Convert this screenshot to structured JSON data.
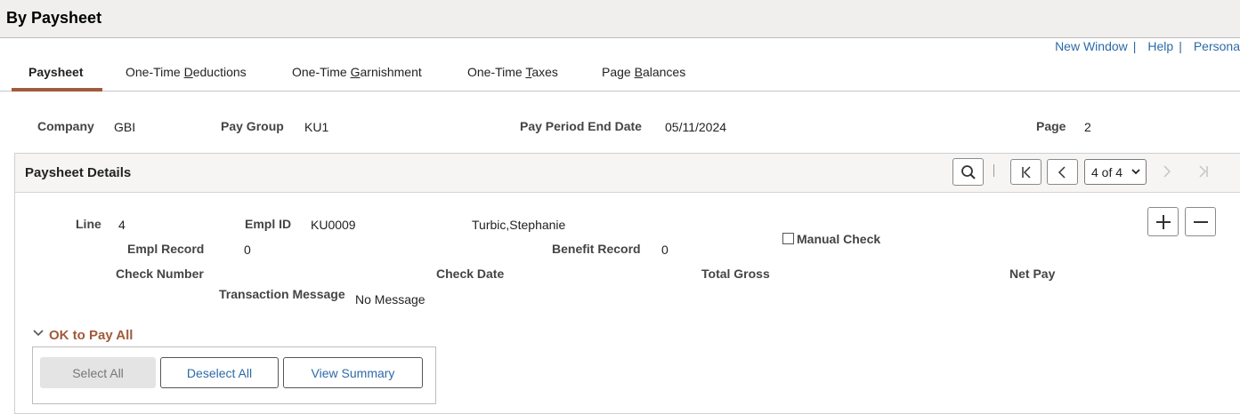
{
  "page": {
    "title": "By Paysheet"
  },
  "top_links": [
    {
      "label": "New Window",
      "sep": "|"
    },
    {
      "label": "Help",
      "sep": "|"
    },
    {
      "label": "Persona"
    }
  ],
  "tabs": [
    {
      "pre": "",
      "key": "",
      "post": "Paysheet",
      "active": true
    },
    {
      "pre": "One-Time ",
      "key": "D",
      "post": "eductions"
    },
    {
      "pre": "One-Time ",
      "key": "G",
      "post": "arnishment"
    },
    {
      "pre": "One-Time ",
      "key": "T",
      "post": "axes"
    },
    {
      "pre": "Page ",
      "key": "B",
      "post": "alances"
    }
  ],
  "header_fields": {
    "company_label": "Company",
    "company_value": "GBI",
    "pay_group_label": "Pay Group",
    "pay_group_value": "KU1",
    "pay_period_label": "Pay Period End Date",
    "pay_period_value": "05/11/2024",
    "page_label": "Page",
    "page_value": "2"
  },
  "details": {
    "title": "Paysheet Details",
    "pager": {
      "value": "4 of 4"
    },
    "line_label": "Line",
    "line_value": "4",
    "empl_id_label": "Empl ID",
    "empl_id_value": "KU0009",
    "name_value": "Turbic,Stephanie",
    "empl_record_label": "Empl Record",
    "empl_record_value": "0",
    "benefit_record_label": "Benefit Record",
    "benefit_record_value": "0",
    "manual_check_label": "Manual Check",
    "manual_check_checked": false,
    "check_number_label": "Check Number",
    "check_date_label": "Check Date",
    "total_gross_label": "Total Gross",
    "net_pay_label": "Net Pay",
    "transaction_message_label": "Transaction Message",
    "transaction_message_value": "No Message"
  },
  "ok_to_pay": {
    "title": "OK to Pay All",
    "select_all": "Select All",
    "deselect_all": "Deselect All",
    "view_summary": "View Summary"
  },
  "colors": {
    "link": "#2d6aa6",
    "accent": "#a15a3a"
  }
}
